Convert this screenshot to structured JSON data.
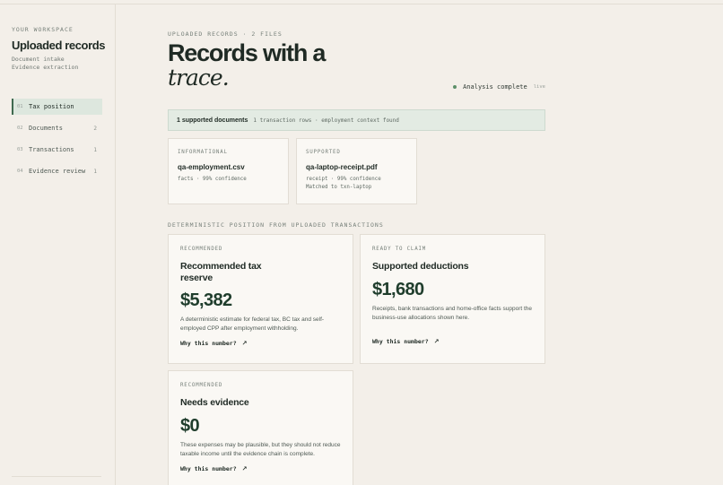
{
  "sidebar": {
    "kicker": "YOUR WORKSPACE",
    "title": "Uploaded records",
    "subtitle_1": "Document intake",
    "subtitle_2": "Evidence extraction",
    "items": [
      {
        "num": "01",
        "label": "Tax position",
        "count": ""
      },
      {
        "num": "02",
        "label": "Documents",
        "count": "2"
      },
      {
        "num": "03",
        "label": "Transactions",
        "count": "1"
      },
      {
        "num": "04",
        "label": "Evidence review",
        "count": "1"
      }
    ]
  },
  "header": {
    "kicker": "UPLOADED RECORDS · 2 FILES",
    "title_line1": "Records with a",
    "title_line2": "trace."
  },
  "status": {
    "label": "Analysis complete",
    "badge": "live"
  },
  "banner": {
    "title": "1 supported documents",
    "detail": "1 transaction rows · employment context found"
  },
  "files": [
    {
      "kicker": "INFORMATIONAL",
      "name": "qa-employment.csv",
      "meta_1": "facts · 99% confidence",
      "meta_2": ""
    },
    {
      "kicker": "SUPPORTED",
      "name": "qa-laptop-receipt.pdf",
      "meta_1": "receipt · 99% confidence",
      "meta_2": "Matched to txn-laptop"
    }
  ],
  "position": {
    "kicker": "DETERMINISTIC POSITION FROM UPLOADED TRANSACTIONS",
    "cards": [
      {
        "kicker": "RECOMMENDED",
        "title_1": "Recommended tax",
        "title_2": "reserve",
        "amount": "$5,382",
        "desc": "A deterministic estimate for federal tax, BC tax and self-employed CPP after employment withholding.",
        "link": "Why this number?"
      },
      {
        "kicker": "READY TO CLAIM",
        "title_1": "Supported deductions",
        "title_2": "",
        "amount": "$1,680",
        "desc": "Receipts, bank transactions and home-office facts support the business-use allocations shown here.",
        "link": "Why this number?"
      },
      {
        "kicker": "RECOMMENDED",
        "title_1": "Needs evidence",
        "title_2": "",
        "amount": "$0",
        "desc": "These expenses may be plausible, but they should not reduce taxable income until the evidence chain is complete.",
        "link": "Why this number?"
      }
    ]
  },
  "icons": {
    "link_arrow": "↗",
    "status_dot": "status-dot-icon"
  },
  "colors": {
    "background": "#f3efe9",
    "accent": "#3f6a4f",
    "banner": "#e3ebe3",
    "amount": "#1f3d2c"
  }
}
